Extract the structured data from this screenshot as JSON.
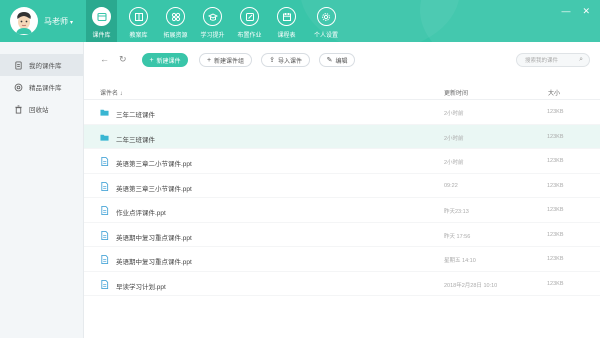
{
  "user": {
    "name": "马老师",
    "caret": "▾"
  },
  "nav": {
    "tabs": [
      {
        "label": "课件库",
        "icon": "courseware-icon",
        "active": true
      },
      {
        "label": "教案库",
        "icon": "lesson-plan-icon",
        "active": false
      },
      {
        "label": "拓展资源",
        "icon": "resources-icon",
        "active": false
      },
      {
        "label": "学习提升",
        "icon": "study-icon",
        "active": false
      },
      {
        "label": "布置作业",
        "icon": "homework-icon",
        "active": false
      },
      {
        "label": "课程表",
        "icon": "schedule-icon",
        "active": false
      },
      {
        "label": "个人设置",
        "icon": "settings-icon",
        "active": false
      }
    ]
  },
  "window": {
    "minimize": "—",
    "close": "✕"
  },
  "sidebar": {
    "items": [
      {
        "label": "我的课件库",
        "icon": "document-icon",
        "active": true
      },
      {
        "label": "精品课件库",
        "icon": "premium-icon",
        "active": false
      },
      {
        "label": "回收站",
        "icon": "trash-icon",
        "active": false
      }
    ]
  },
  "toolbar": {
    "back": "←",
    "refresh": "↻",
    "new_courseware": "新建课件",
    "new_group": "新建课件组",
    "import": "导入课件",
    "edit": "编辑",
    "search_placeholder": "搜索我的课件"
  },
  "table": {
    "headers": {
      "name": "课件名 ↓",
      "updated": "更新时间",
      "size": "大小"
    },
    "rows": [
      {
        "type": "folder",
        "name": "三年二班课件",
        "time": "2小时前",
        "size": "123KB",
        "selected": false
      },
      {
        "type": "folder",
        "name": "二年三班课件",
        "time": "2小时前",
        "size": "123KB",
        "selected": true
      },
      {
        "type": "file",
        "name": "英语第三章二小节课件.ppt",
        "time": "2小时前",
        "size": "123KB",
        "selected": false
      },
      {
        "type": "file",
        "name": "英语第三章三小节课件.ppt",
        "time": "09:22",
        "size": "123KB",
        "selected": false
      },
      {
        "type": "file",
        "name": "作业点评课件.ppt",
        "time": "昨天23:13",
        "size": "123KB",
        "selected": false
      },
      {
        "type": "file",
        "name": "英语期中复习重点课件.ppt",
        "time": "昨天 17:56",
        "size": "123KB",
        "selected": false
      },
      {
        "type": "file",
        "name": "英语期中复习重点课件.ppt",
        "time": "星期五 14:10",
        "size": "123KB",
        "selected": false
      },
      {
        "type": "file",
        "name": "早读学习计划.ppt",
        "time": "2018年2月28日 10:10",
        "size": "123KB",
        "selected": false
      }
    ]
  },
  "colors": {
    "accent": "#39c5a9",
    "accent_dark": "#2aa98f",
    "folder": "#39b6d2",
    "file": "#4aa6d8"
  }
}
